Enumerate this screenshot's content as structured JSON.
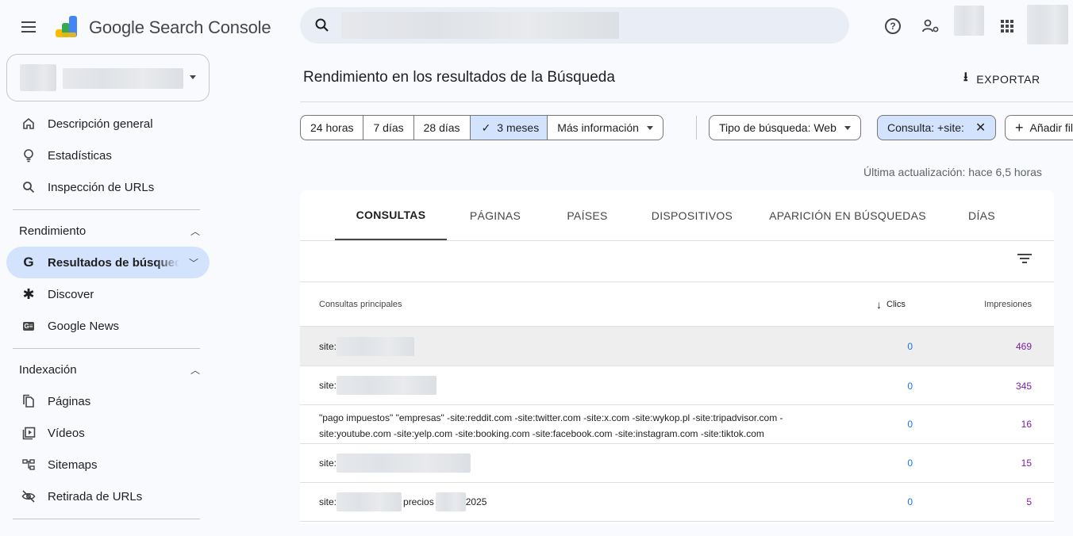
{
  "app": {
    "title": "Google Search Console"
  },
  "header": {
    "icons": [
      "menu-icon",
      "search-icon",
      "help-icon",
      "admin-settings-icon",
      "apps-grid-icon"
    ],
    "help_glyph": "?",
    "admin_glyph": "⚙"
  },
  "sidebar": {
    "top_items": [
      {
        "label": "Descripción general",
        "icon": "home-icon"
      },
      {
        "label": "Estadísticas",
        "icon": "lightbulb-icon"
      },
      {
        "label": "Inspección de URLs",
        "icon": "search-icon"
      }
    ],
    "sections": [
      {
        "title": "Rendimiento",
        "items": [
          {
            "label": "Resultados de búsqueda",
            "icon": "google-g-icon",
            "glyph": "G",
            "active": true
          },
          {
            "label": "Discover",
            "icon": "asterisk-icon",
            "glyph": "✱"
          },
          {
            "label": "Google News",
            "icon": "google-news-icon",
            "glyph": "G≡"
          }
        ]
      },
      {
        "title": "Indexación",
        "items": [
          {
            "label": "Páginas",
            "icon": "pages-icon"
          },
          {
            "label": "Vídeos",
            "icon": "video-icon",
            "glyph": "▶"
          },
          {
            "label": "Sitemaps",
            "icon": "sitemap-icon"
          },
          {
            "label": "Retirada de URLs",
            "icon": "visibility-off-icon"
          }
        ]
      }
    ]
  },
  "main": {
    "title": "Rendimiento en los resultados de la Búsqueda",
    "export_label": "EXPORTAR",
    "export_glyph": "⭳",
    "date_ranges": [
      "24 horas",
      "7 días",
      "28 días",
      "3 meses",
      "Más información"
    ],
    "date_selected": "3 meses",
    "check_glyph": "✓",
    "search_type": "Tipo de búsqueda: Web",
    "query_filter": "Consulta: +site:",
    "close_glyph": "✕",
    "add_filter": "Añadir filtro",
    "plus_glyph": "+",
    "last_updated": "Última actualización: hace 6,5 horas",
    "tabs": [
      "CONSULTAS",
      "PÁGINAS",
      "PAÍSES",
      "DISPOSITIVOS",
      "APARICIÓN EN BÚSQUEDAS",
      "DÍAS"
    ],
    "active_tab": "CONSULTAS",
    "table": {
      "headers": {
        "query": "Consultas principales",
        "clicks": "Clics",
        "impressions": "Impresiones"
      },
      "sort_glyph": "↓",
      "rows": [
        {
          "query_prefix": "site:",
          "query_suffix": "",
          "clicks": "0",
          "impressions": "469"
        },
        {
          "query_prefix": "site:",
          "query_suffix": "",
          "clicks": "0",
          "impressions": "345"
        },
        {
          "query_line1": "\"pago impuestos\" \"empresas\" -site:reddit.com -site:twitter.com -site:x.com -site:wykop.pl -site:tripadvisor.com -",
          "query_line2": "site:youtube.com -site:yelp.com -site:booking.com -site:facebook.com -site:instagram.com -site:tiktok.com",
          "clicks": "0",
          "impressions": "16"
        },
        {
          "query_prefix": "site:",
          "query_suffix": "",
          "clicks": "0",
          "impressions": "15"
        },
        {
          "query_prefix": "site:",
          "query_mid": "precios",
          "query_suffix": "2025",
          "clicks": "0",
          "impressions": "5"
        }
      ]
    }
  },
  "colors": {
    "accent_blue": "#1a73e8",
    "impressions_purple": "#7b1fa2",
    "selected_bg": "#d3e3fd",
    "search_bg": "#e9eef6"
  }
}
